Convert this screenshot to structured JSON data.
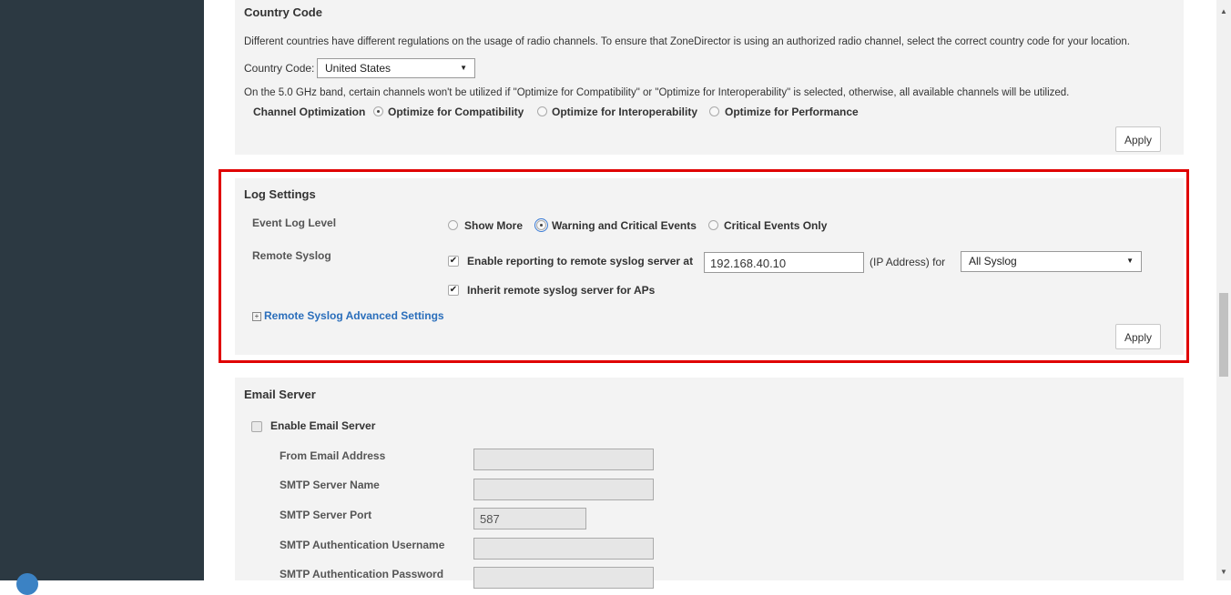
{
  "country": {
    "title": "Country Code",
    "description": "Different countries have different regulations on the usage of radio channels. To ensure that ZoneDirector is using an authorized radio channel, select the correct country code for your location.",
    "field_label": "Country Code:",
    "selected": "United States",
    "band_note": "On the 5.0 GHz band, certain channels won't be utilized if \"Optimize for Compatibility\" or \"Optimize for Interoperability\" is selected, otherwise, all available channels will be utilized.",
    "opt_label": "Channel Optimization",
    "options": [
      "Optimize for Compatibility",
      "Optimize for Interoperability",
      "Optimize for Performance"
    ],
    "selected_option": "Optimize for Compatibility",
    "apply_label": "Apply"
  },
  "log": {
    "title": "Log Settings",
    "event_label": "Event Log Level",
    "event_options": [
      "Show More",
      "Warning and Critical Events",
      "Critical Events Only"
    ],
    "event_selected": "Warning and Critical Events",
    "syslog_label": "Remote Syslog",
    "enable_label": "Enable reporting to remote syslog server at",
    "enable_checked": true,
    "server_ip": "192.168.40.10",
    "ip_suffix": "(IP Address) for",
    "facility_selected": "All Syslog",
    "inherit_label": "Inherit remote syslog server for APs",
    "inherit_checked": true,
    "advanced_link": "Remote Syslog Advanced Settings",
    "apply_label": "Apply"
  },
  "email": {
    "title": "Email Server",
    "enable_label": "Enable Email Server",
    "enable_checked": false,
    "fields": [
      {
        "label": "From Email Address",
        "value": ""
      },
      {
        "label": "SMTP Server Name",
        "value": ""
      },
      {
        "label": "SMTP Server Port",
        "value": "587"
      },
      {
        "label": "SMTP Authentication Username",
        "value": ""
      },
      {
        "label": "SMTP Authentication Password",
        "value": ""
      }
    ]
  },
  "colors": {
    "highlight": "#e00000",
    "sidebar": "#2c3942",
    "link": "#2a6ebb"
  }
}
